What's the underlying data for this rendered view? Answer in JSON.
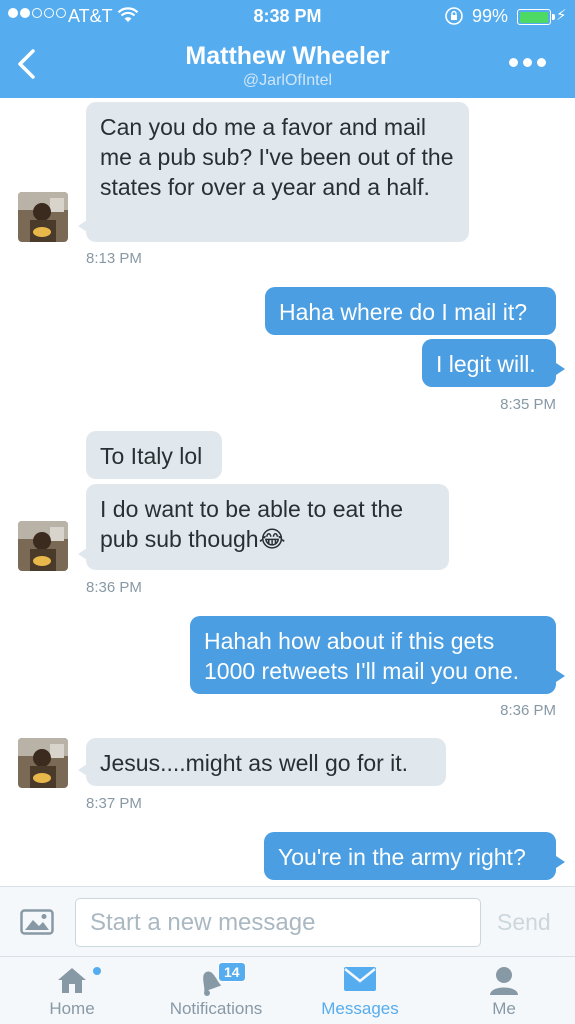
{
  "status_bar": {
    "carrier": "AT&T",
    "time": "8:38 PM",
    "battery": "99%",
    "battery_level": 0.99
  },
  "header": {
    "title": "Matthew Wheeler",
    "handle": "@JarlOfIntel"
  },
  "messages": [
    {
      "text": "Can you do me a favor and mail me a pub sub? I've been out of the states for over a year and a half."
    },
    {
      "time": "8:13 PM"
    },
    {
      "text": "Haha where do I mail it?"
    },
    {
      "text": "I legit will."
    },
    {
      "time": "8:35 PM"
    },
    {
      "text": "To Italy lol"
    },
    {
      "text": "I do want to be able to eat the pub sub though😂"
    },
    {
      "time": "8:36 PM"
    },
    {
      "text": "Hahah how about if this gets 1000 retweets I'll mail you one."
    },
    {
      "time": "8:36 PM"
    },
    {
      "text": "Jesus....might as well go for it."
    },
    {
      "time": "8:37 PM"
    },
    {
      "text": "You're in the army right?"
    }
  ],
  "composer": {
    "placeholder": "Start a new message",
    "send_label": "Send"
  },
  "tabs": [
    {
      "label": "Home",
      "icon": "home-icon"
    },
    {
      "label": "Notifications",
      "icon": "bell-icon",
      "badge": "14"
    },
    {
      "label": "Messages",
      "icon": "envelope-icon",
      "active": true
    },
    {
      "label": "Me",
      "icon": "person-icon"
    }
  ],
  "colors": {
    "brand": "#55acee",
    "outgoing_bubble": "#4a9ee1",
    "incoming_bubble": "#e1e8ed"
  }
}
